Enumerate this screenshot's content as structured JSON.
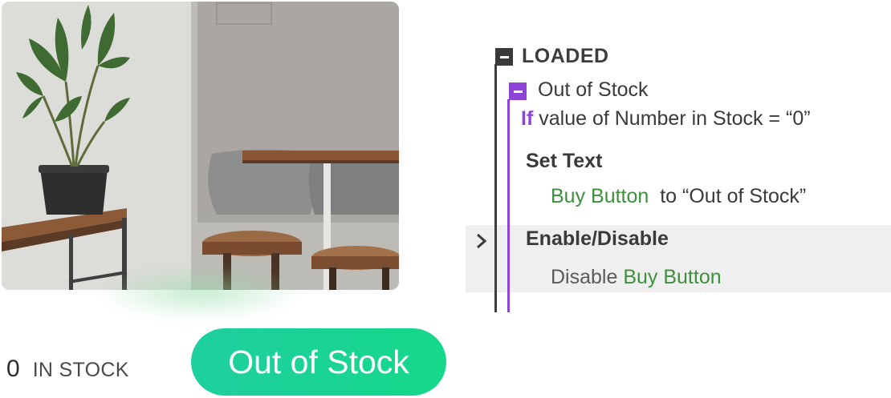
{
  "product": {
    "image_icon": "cafe-photo",
    "stock_count": "0",
    "stock_label": "IN STOCK",
    "buy_button_label": "Out of Stock",
    "button_color": "#15d88a"
  },
  "workflow": {
    "event_label": "LOADED",
    "condition_group_label": "Out of Stock",
    "condition_keyword": "If",
    "condition_text": "value of Number in Stock = “0”",
    "actions": [
      {
        "label": "Set Text",
        "target": "Buy Button",
        "detail": "to “Out of Stock”"
      },
      {
        "label": "Enable/Disable",
        "verb": "Disable",
        "target": "Buy Button"
      }
    ],
    "accent_color": "#8e44d6",
    "target_color": "#3f8f3f",
    "icons": [
      "collapse-icon",
      "collapse-icon",
      "chevron-right-icon"
    ]
  }
}
